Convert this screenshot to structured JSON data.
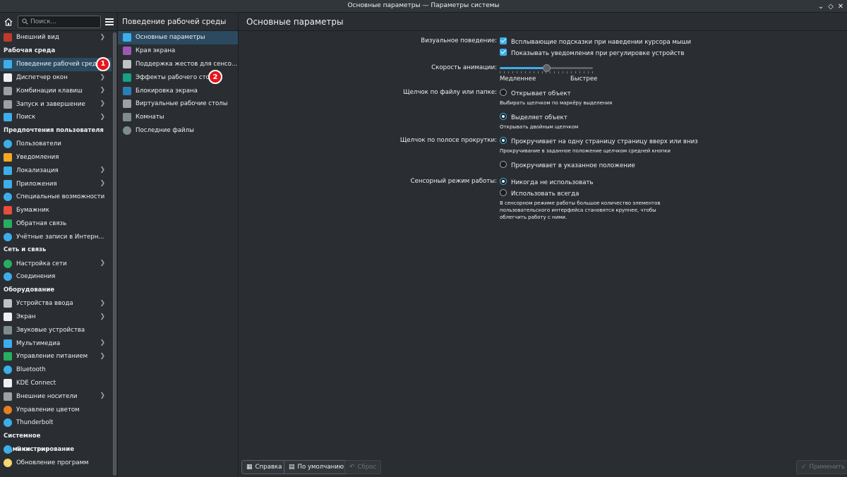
{
  "window": {
    "title": "Основные параметры — Параметры системы"
  },
  "search": {
    "placeholder": "Поиск..."
  },
  "sidebar": {
    "entries": [
      {
        "type": "item",
        "label": "Внешний вид",
        "icon": "appearance-icon",
        "color": "#c0392b",
        "chevron": true
      },
      {
        "type": "group",
        "label": "Рабочая среда"
      },
      {
        "type": "item",
        "label": "Поведение рабочей среды",
        "icon": "workspace-behavior-icon",
        "color": "#3daee9",
        "chevron": true,
        "active": true,
        "badge": "1"
      },
      {
        "type": "item",
        "label": "Диспетчер окон",
        "icon": "window-manager-icon",
        "color": "#eff0f1",
        "chevron": true
      },
      {
        "type": "item",
        "label": "Комбинации клавиш",
        "icon": "keyboard-icon",
        "color": "#9da1a5",
        "chevron": true
      },
      {
        "type": "item",
        "label": "Запуск и завершение",
        "icon": "startup-icon",
        "color": "#9da1a5",
        "chevron": true
      },
      {
        "type": "item",
        "label": "Поиск",
        "icon": "search-icon",
        "color": "#3daee9",
        "chevron": true
      },
      {
        "type": "group",
        "label": "Предпочтения пользователя"
      },
      {
        "type": "item",
        "label": "Пользователи",
        "icon": "users-icon",
        "color": "#3daee9",
        "round": true
      },
      {
        "type": "item",
        "label": "Уведомления",
        "icon": "bell-icon",
        "color": "#f5a623"
      },
      {
        "type": "item",
        "label": "Локализация",
        "icon": "localization-icon",
        "color": "#3daee9",
        "chevron": true
      },
      {
        "type": "item",
        "label": "Приложения",
        "icon": "applications-icon",
        "color": "#3daee9",
        "chevron": true
      },
      {
        "type": "item",
        "label": "Специальные возможности",
        "icon": "accessibility-icon",
        "color": "#3daee9",
        "round": true
      },
      {
        "type": "item",
        "label": "Бумажник",
        "icon": "wallet-icon",
        "color": "#e74c3c"
      },
      {
        "type": "item",
        "label": "Обратная связь",
        "icon": "feedback-icon",
        "color": "#27ae60"
      },
      {
        "type": "item",
        "label": "Учётные записи в Интерн...",
        "icon": "online-accounts-icon",
        "color": "#3daee9",
        "round": true
      },
      {
        "type": "group",
        "label": "Сеть и связь"
      },
      {
        "type": "item",
        "label": "Настройка сети",
        "icon": "network-icon",
        "color": "#27ae60",
        "round": true,
        "chevron": true
      },
      {
        "type": "item",
        "label": "Соединения",
        "icon": "connections-icon",
        "color": "#3daee9",
        "round": true
      },
      {
        "type": "group",
        "label": "Оборудование"
      },
      {
        "type": "item",
        "label": "Устройства ввода",
        "icon": "mouse-icon",
        "color": "#bdc3c7",
        "chevron": true
      },
      {
        "type": "item",
        "label": "Экран",
        "icon": "display-icon",
        "color": "#eff0f1",
        "chevron": true
      },
      {
        "type": "item",
        "label": "Звуковые устройства",
        "icon": "audio-icon",
        "color": "#7f8c8d"
      },
      {
        "type": "item",
        "label": "Мультимедиа",
        "icon": "multimedia-icon",
        "color": "#3daee9",
        "chevron": true
      },
      {
        "type": "item",
        "label": "Управление питанием",
        "icon": "power-icon",
        "color": "#27ae60",
        "chevron": true
      },
      {
        "type": "item",
        "label": "Bluetooth",
        "icon": "bluetooth-icon",
        "color": "#3daee9",
        "round": true
      },
      {
        "type": "item",
        "label": "KDE Connect",
        "icon": "kde-connect-icon",
        "color": "#eff0f1"
      },
      {
        "type": "item",
        "label": "Внешние носители",
        "icon": "removable-media-icon",
        "color": "#9da1a5",
        "chevron": true
      },
      {
        "type": "item",
        "label": "Управление цветом",
        "icon": "color-management-icon",
        "color": "#e67e22",
        "round": true
      },
      {
        "type": "item",
        "label": "Thunderbolt",
        "icon": "thunderbolt-icon",
        "color": "#3daee9",
        "round": true
      },
      {
        "type": "group",
        "label": "Системное администрирование"
      },
      {
        "type": "item",
        "label": "О системе",
        "icon": "info-icon",
        "color": "#3daee9",
        "round": true
      },
      {
        "type": "item",
        "label": "Обновление программ",
        "icon": "update-icon",
        "color": "#f5d76e",
        "round": true
      }
    ]
  },
  "midcol": {
    "header": "Поведение рабочей среды",
    "items": [
      {
        "label": "Основные параметры",
        "icon": "general-behavior-icon",
        "color": "#3daee9",
        "active": true
      },
      {
        "label": "Края экрана",
        "icon": "screen-edges-icon",
        "color": "#9b59b6"
      },
      {
        "label": "Поддержка жестов для сенсо...",
        "icon": "touchscreen-icon",
        "color": "#bdc3c7"
      },
      {
        "label": "Эффекты рабочего стола",
        "icon": "desktop-effects-icon",
        "color": "#16a085",
        "badge": "2"
      },
      {
        "label": "Блокировка экрана",
        "icon": "screen-lock-icon",
        "color": "#2980b9"
      },
      {
        "label": "Виртуальные рабочие столы",
        "icon": "virtual-desktops-icon",
        "color": "#9da1a5"
      },
      {
        "label": "Комнаты",
        "icon": "activities-icon",
        "color": "#7f8c8d"
      },
      {
        "label": "Последние файлы",
        "icon": "recent-files-icon",
        "color": "#7f8c8d",
        "round": true
      }
    ]
  },
  "main": {
    "header": "Основные параметры",
    "visual": {
      "label": "Визуальное поведение:",
      "opt1": "Всплывающие подсказки при наведении курсора мыши",
      "opt2": "Показывать уведомления при регулировке устройств"
    },
    "animation": {
      "label": "Скорость анимации:",
      "slow": "Медленнее",
      "fast": "Быстрее",
      "value": 0.5
    },
    "click": {
      "label": "Щелчок по файлу или папке:",
      "opt1": "Открывает объект",
      "hint1": "Выбирать щелчком по маркёру выделения",
      "opt2": "Выделяет объект",
      "hint2": "Открывать двойным щелчком",
      "selected": 2
    },
    "scrollbar": {
      "label": "Щелчок по полосе прокрутки:",
      "opt1": "Прокручивает на одну страницу страницу вверх или вниз",
      "hint1": "Прокручивание в заданное положение щелчком средней кнопки",
      "opt2": "Прокручивает в указанное положение",
      "selected": 1
    },
    "touch": {
      "label": "Сенсорный режим работы:",
      "opt1": "Никогда не использовать",
      "opt2": "Использовать всегда",
      "hint": "В сенсорном режиме работы большое количество элементов пользовательского интерфейса становятся крупнее, чтобы облегчить работу с ними.",
      "selected": 1
    }
  },
  "footer": {
    "help": "Справка",
    "defaults": "По умолчанию",
    "reset": "Сброс",
    "apply": "Применить"
  },
  "colors": {
    "accent": "#3daee9",
    "selection": "#2c4a5f",
    "badge": "#e8141b",
    "background": "#2a2e32"
  }
}
